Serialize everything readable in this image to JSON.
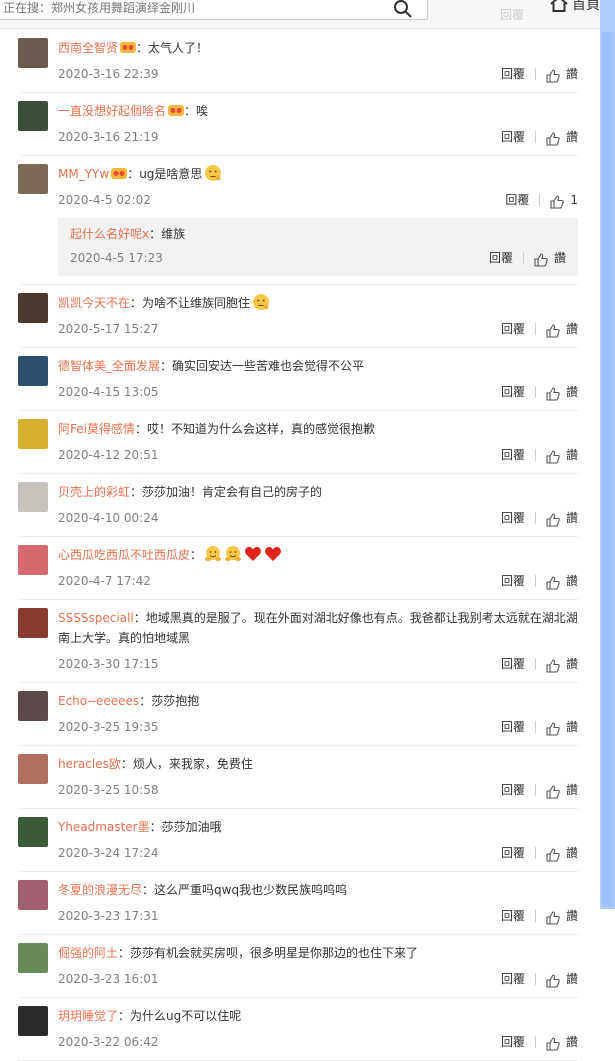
{
  "search": {
    "placeholder": "正在搜：郑州女孩用舞蹈演绎金刚川"
  },
  "header": {
    "reply_label": "回覆",
    "home_label": "首頁"
  },
  "comments": [
    {
      "user": "西南全智贤",
      "vip": true,
      "text": "太气人了！",
      "emoji": [],
      "time": "2020-3-16 22:39",
      "reply": "回覆",
      "like": "讚"
    },
    {
      "user": "一直没想好起個啥名",
      "vip": true,
      "text": "唉",
      "emoji": [],
      "time": "2020-3-16 21:19",
      "reply": "回覆",
      "like": "讚"
    },
    {
      "user": "MM_YYw",
      "vip": true,
      "text": "ug是啥意思",
      "emoji": [
        "thinking-emoji"
      ],
      "time": "2020-4-5 02:02",
      "reply": "回覆",
      "like": "1",
      "subreply": {
        "user": "起什么名好呢x",
        "text": "维族",
        "time": "2020-4-5 17:23",
        "reply": "回覆",
        "like": "讚"
      }
    },
    {
      "user": "凯凯今天不在",
      "vip": false,
      "text": "为啥不让维族同胞住",
      "emoji": [
        "thinking-emoji"
      ],
      "time": "2020-5-17 15:27",
      "reply": "回覆",
      "like": "讚"
    },
    {
      "user": "德智体美_全面发展",
      "vip": false,
      "text": "确实回安达一些苦难也会觉得不公平",
      "emoji": [],
      "time": "2020-4-15 13:05",
      "reply": "回覆",
      "like": "讚"
    },
    {
      "user": "阿Fei莫得感情",
      "vip": false,
      "text": "哎！不知道为什么会这样，真的感觉很抱歉",
      "emoji": [],
      "time": "2020-4-12 20:51",
      "reply": "回覆",
      "like": "讚"
    },
    {
      "user": "贝壳上的彩虹",
      "vip": false,
      "text": "莎莎加油！肯定会有自己的房子的",
      "emoji": [],
      "time": "2020-4-10 00:24",
      "reply": "回覆",
      "like": "讚"
    },
    {
      "user": "心西瓜吃西瓜不吐西瓜皮",
      "vip": false,
      "text": "",
      "emoji": [
        "hug-emoji",
        "hug-emoji",
        "heart-emoji",
        "heart-emoji"
      ],
      "time": "2020-4-7 17:42",
      "reply": "回覆",
      "like": "讚"
    },
    {
      "user": "SSSSspeciall",
      "vip": false,
      "text": "地域黑真的是服了。现在外面对湖北好像也有点。我爸都让我别考太远就在湖北湖南上大学。真的怕地域黑",
      "emoji": [],
      "time": "2020-3-30 17:15",
      "reply": "回覆",
      "like": "讚"
    },
    {
      "user": "Echo--eeeees",
      "vip": false,
      "text": "莎莎抱抱",
      "emoji": [],
      "time": "2020-3-25 19:35",
      "reply": "回覆",
      "like": "讚"
    },
    {
      "user": "heracles欧",
      "vip": false,
      "text": "烦人，来我家，免费住",
      "emoji": [],
      "time": "2020-3-25 10:58",
      "reply": "回覆",
      "like": "讚"
    },
    {
      "user": "Yheadmaster墨",
      "vip": false,
      "text": "莎莎加油哦",
      "emoji": [],
      "time": "2020-3-24 17:24",
      "reply": "回覆",
      "like": "讚"
    },
    {
      "user": "冬夏的浪漫无尽",
      "vip": false,
      "text": "这么严重吗qwq我也少数民族呜呜呜",
      "emoji": [],
      "time": "2020-3-23 17:31",
      "reply": "回覆",
      "like": "讚"
    },
    {
      "user": "倔强的阿土",
      "vip": false,
      "text": "莎莎有机会就买房呗，很多明星是你那边的也住下来了",
      "emoji": [],
      "time": "2020-3-23 16:01",
      "reply": "回覆",
      "like": "讚"
    },
    {
      "user": "玥玥睡觉了",
      "vip": false,
      "text": "为什么ug不可以住呢",
      "emoji": [],
      "time": "2020-3-22 06:42",
      "reply": "回覆",
      "like": "讚"
    }
  ],
  "colors": {
    "username": "#eb7350",
    "timestamp": "#808080",
    "scrollbar": "#aecdfb",
    "subreply_bg": "#f2f2f2",
    "avatars": [
      "#6b5a4e",
      "#3b4e3a",
      "#7b6a5a",
      "#4a3a2e",
      "#2f4f6f",
      "#d8b030",
      "#c9c3be",
      "#d66a6a",
      "#8a3a2e",
      "#5a4a4a",
      "#b07060",
      "#3a5a3a",
      "#a06070",
      "#6a8a5a",
      "#2a2a2a"
    ]
  }
}
